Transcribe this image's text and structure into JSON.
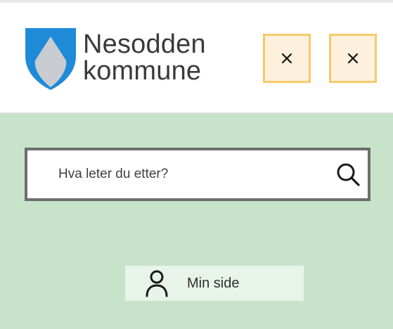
{
  "header": {
    "logo_line1": "Nesodden",
    "logo_line2": "kommune",
    "close_buttons": [
      {
        "icon": "close-icon"
      },
      {
        "icon": "close-icon"
      }
    ]
  },
  "search": {
    "placeholder": "Hva leter du etter?",
    "icon": "search-icon"
  },
  "min_side": {
    "label": "Min side",
    "icon": "person-icon"
  },
  "colors": {
    "panel_bg": "#c7e4cb",
    "button_border": "#f7c96b",
    "button_bg": "#fdf0dd",
    "logo_blue": "#1f8bd8",
    "logo_gray": "#c9ccd0"
  }
}
